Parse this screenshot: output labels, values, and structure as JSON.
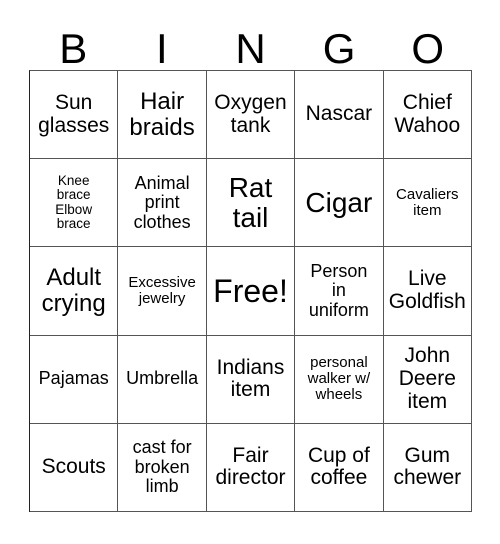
{
  "card": {
    "title": "BINGO",
    "header_letters": [
      "B",
      "I",
      "N",
      "G",
      "O"
    ],
    "free_space_label": "Free!",
    "colors": {
      "background": "#ffffff",
      "text": "#000000",
      "grid_line": "#555555"
    },
    "rows": [
      [
        {
          "text": "Sun\nglasses",
          "size": "m"
        },
        {
          "text": "Hair\nbraids",
          "size": "l"
        },
        {
          "text": "Oxygen\ntank",
          "size": "m"
        },
        {
          "text": "Nascar",
          "size": "m"
        },
        {
          "text": "Chief\nWahoo",
          "size": "m"
        }
      ],
      [
        {
          "text": "Knee\nbrace\nElbow\nbrace",
          "size": "xxs"
        },
        {
          "text": "Animal\nprint\nclothes",
          "size": "s"
        },
        {
          "text": "Rat\ntail",
          "size": "xl"
        },
        {
          "text": "Cigar",
          "size": "xl"
        },
        {
          "text": "Cavaliers\nitem",
          "size": "xs"
        }
      ],
      [
        {
          "text": "Adult\ncrying",
          "size": "l"
        },
        {
          "text": "Excessive\njewelry",
          "size": "xs"
        },
        {
          "text": "Free!",
          "size": "xxl"
        },
        {
          "text": "Person\nin\nuniform",
          "size": "s"
        },
        {
          "text": "Live\nGoldfish",
          "size": "m"
        }
      ],
      [
        {
          "text": "Pajamas",
          "size": "s"
        },
        {
          "text": "Umbrella",
          "size": "s"
        },
        {
          "text": "Indians\nitem",
          "size": "m"
        },
        {
          "text": "personal\nwalker w/\nwheels",
          "size": "xs"
        },
        {
          "text": "John\nDeere\nitem",
          "size": "m"
        }
      ],
      [
        {
          "text": "Scouts",
          "size": "m"
        },
        {
          "text": "cast for\nbroken\nlimb",
          "size": "s"
        },
        {
          "text": "Fair\ndirector",
          "size": "m"
        },
        {
          "text": "Cup of\ncoffee",
          "size": "m"
        },
        {
          "text": "Gum\nchewer",
          "size": "m"
        }
      ]
    ]
  }
}
